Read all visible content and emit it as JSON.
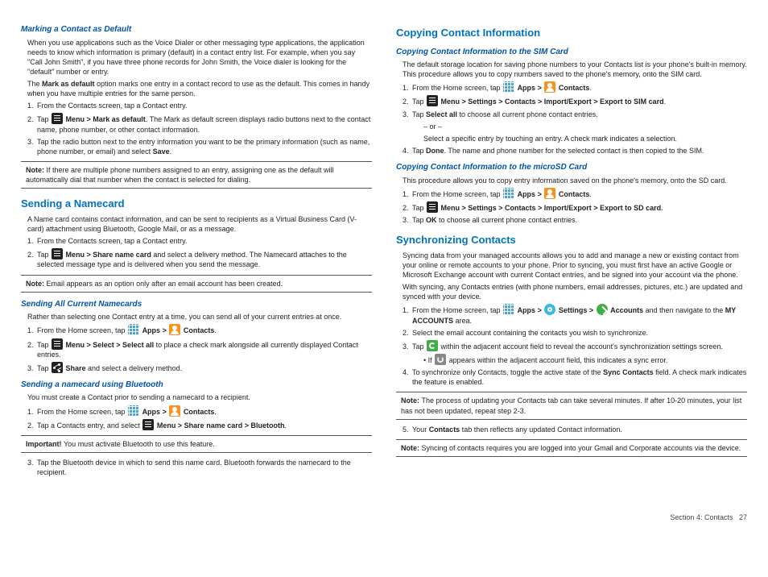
{
  "left": {
    "s1": {
      "h": "Marking a Contact as Default",
      "p1": "When you use applications such as the Voice Dialer or other messaging type applications, the application needs to know which information is primary (default) in a contact entry list. For example, when you say \"Call John Smith\", if you have three phone records for John Smith, the Voice dialer is looking for the \"default\" number or entry.",
      "p2a": "The ",
      "p2b": "Mark as default",
      "p2c": " option marks one entry in a contact record to use as the default. This comes in handy when you have multiple entries for the same person.",
      "li1": "From the Contacts screen, tap a Contact entry.",
      "li2a": "Tap  ",
      "li2b": "Menu > Mark as default",
      "li2c": ". The Mark as default screen displays radio buttons next to the contact name, phone number, or other contact information.",
      "li3a": "Tap the radio button next to the entry information you want to be the primary information (such as name, phone number, or email) and select ",
      "li3b": "Save",
      "li3c": ".",
      "note": "If there are multiple phone numbers assigned to an entry, assigning one as the default will automatically dial that number when the contact is selected for dialing."
    },
    "s2": {
      "h": "Sending a Namecard",
      "p1": "A Name card contains contact information, and can be sent to recipients as a Virtual Business Card (V-card) attachment using Bluetooth, Google Mail, or as a message.",
      "li1": "From the Contacts screen, tap a Contact entry.",
      "li2a": "Tap  ",
      "li2b": "Menu > Share name card",
      "li2c": " and select a delivery method. The Namecard attaches to the selected message type and is delivered when you send the message.",
      "note": "Email appears as an option only after an email account has been created."
    },
    "s3": {
      "h": "Sending All Current Namecards",
      "p1": "Rather than selecting one Contact entry at a time, you can send all of your current entries at once.",
      "li1a": "From the Home screen, tap  ",
      "li1b": "Apps > ",
      "li1c": "Contacts",
      "li1d": ".",
      "li2a": "Tap  ",
      "li2b": "Menu > Select > Select all",
      "li2c": " to place a check mark alongside all currently displayed Contact entries.",
      "li3a": "Tap  ",
      "li3b": "Share",
      "li3c": " and select a delivery method."
    },
    "s4": {
      "h": "Sending a namecard using Bluetooth",
      "p1": "You must create a Contact prior to sending a namecard to a recipient.",
      "li1a": "From the Home screen, tap  ",
      "li1b": "Apps > ",
      "li1c": "Contacts",
      "li1d": ".",
      "li2a": "Tap a Contacts entry, and select  ",
      "li2b": "Menu > Share name card > Bluetooth",
      "li2c": ".",
      "impa": "Important! ",
      "impb": "You must activate Bluetooth to use this feature.",
      "li3": "Tap the Bluetooth device in which to send this name card. Bluetooth forwards the namecard to the recipient."
    }
  },
  "right": {
    "s1": {
      "h": "Copying Contact Information",
      "sub1": {
        "h": "Copying Contact Information to the SIM Card",
        "p1": "The default storage location for saving phone numbers to your Contacts list is your phone's built-in memory. This procedure allows you to copy numbers saved to the phone's memory, onto the SIM card.",
        "li1a": "From the Home screen, tap  ",
        "li1b": "Apps > ",
        "li1c": "Contacts",
        "li1d": ".",
        "li2a": "Tap  ",
        "li2b": "Menu > Settings > Contacts > Import/Export > Export to SIM card",
        "li2c": ".",
        "li3a": "Tap ",
        "li3b": "Select all",
        "li3c": " to choose all current phone contact entries.",
        "or": "– or –",
        "li3d": "Select a specific entry by touching an entry. A check mark indicates a selection.",
        "li4a": "Tap ",
        "li4b": "Done",
        "li4c": ". The name and phone number for the selected contact is then copied to the SIM."
      },
      "sub2": {
        "h": "Copying Contact Information to the microSD Card",
        "p1": "This procedure allows you to copy entry information saved on the phone's memory, onto the SD card.",
        "li1a": "From the Home screen, tap  ",
        "li1b": "Apps > ",
        "li1c": "Contacts",
        "li1d": ".",
        "li2a": "Tap  ",
        "li2b": "Menu > Settings > Contacts > Import/Export > Export to SD card",
        "li2c": ".",
        "li3a": "Tap ",
        "li3b": "OK",
        "li3c": " to choose all current phone contact entries."
      }
    },
    "s2": {
      "h": "Synchronizing Contacts",
      "p1": "Syncing data from your managed accounts allows you to add and manage a new or existing contact from your online or remote accounts to your phone. Prior to syncing, you must first have an active Google or Microsoft Exchange account with current Contact entries, and be signed into your account via the phone.",
      "p2": "With syncing, any Contacts entries (with phone numbers, email addresses, pictures, etc.) are updated and synced with your device.",
      "li1a": "From the Home screen, tap  ",
      "li1b": "Apps > ",
      "li1c": "Settings > ",
      "li1d": "Accounts",
      "li1e": " and then navigate to the ",
      "li1f": "MY ACCOUNTS",
      "li1g": " area.",
      "li2": "Select the email account containing the contacts you wish to synchronize.",
      "li3a": "Tap  ",
      "li3b": " within the adjacent account field to reveal the account's synchronization settings screen.",
      "li3ca": "If  ",
      "li3cb": " appears within the adjacent account field, this indicates a sync error.",
      "li4a": "To synchronize only Contacts, toggle the active state of the ",
      "li4b": "Sync Contacts",
      "li4c": " field. A check mark indicates the feature is enabled.",
      "note1": "The process of updating your Contacts tab can take several minutes. If after 10-20 minutes, your list has not been updated, repeat step 2-3.",
      "li5a": "Your ",
      "li5b": "Contacts",
      "li5c": " tab then reflects any updated Contact information.",
      "note2": "Syncing of contacts requires you are logged into your Gmail and Corporate accounts via the device."
    }
  },
  "footer": {
    "section": "Section 4:  Contacts",
    "page": "27"
  }
}
